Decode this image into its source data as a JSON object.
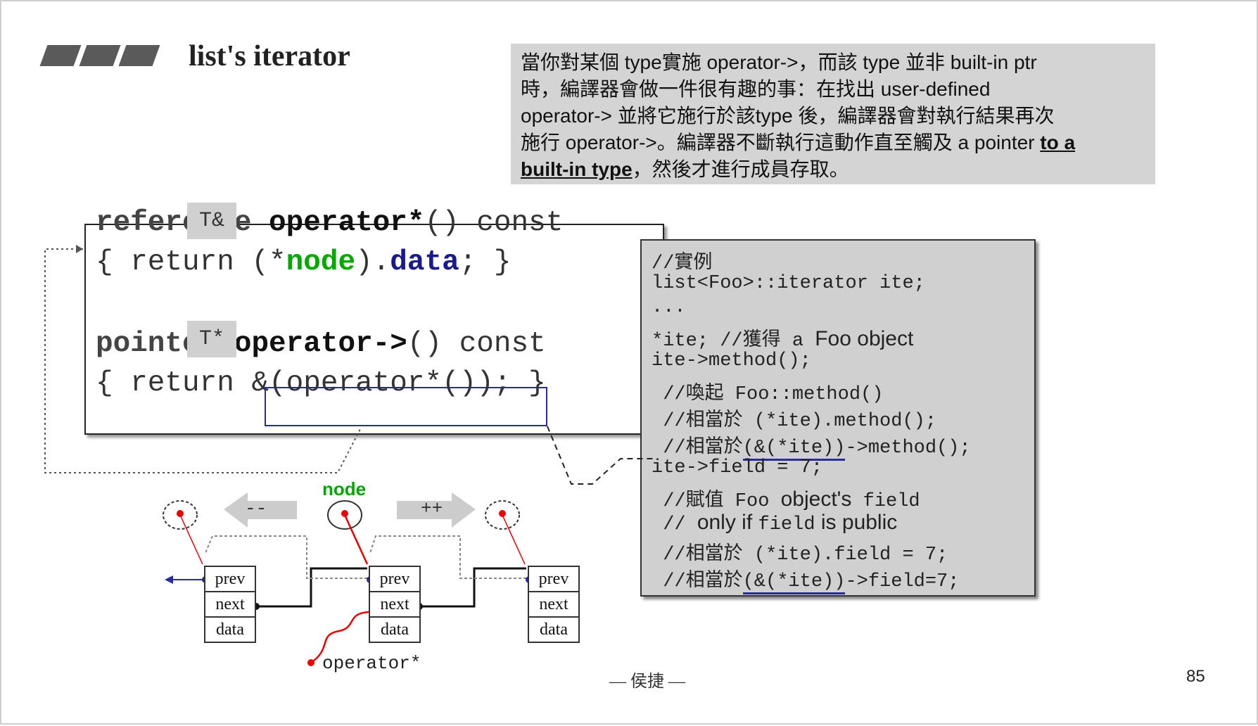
{
  "slide": {
    "title": "list's iterator",
    "page_number": "85",
    "footer": "— 侯捷 —"
  },
  "note": {
    "line1": "當你對某個 type實施 operator->，而該 type 並非 built-in ptr",
    "line2": "時，編譯器會做一件很有趣的事：在找出 user-defined",
    "line3": "operator-> 並將它施行於該type 後，編譯器會對執行結果再次",
    "line4_a": "施行 operator->。編譯器不斷執行這動作直至觸及 a pointer ",
    "line4_b": "to a",
    "line5_a": "built-in type",
    "line5_b": "，然後才進行成員存取。"
  },
  "code": {
    "tag_ref": "T&",
    "tag_ptr": "T*",
    "l1_a": "reference",
    "l1_b": "operator*",
    "l1_c": "() const",
    "l2_a": "{ return (*",
    "l2_node": "node",
    "l2_b": ").",
    "l2_data": "data",
    "l2_c": "; }",
    "l3_a": "pointer",
    "l3_b": "operator->",
    "l3_c": "() const",
    "l4_a": "{ return ",
    "l4_b": "&(operator*())",
    "l4_c": "; }"
  },
  "example": {
    "l1": "//實例",
    "l2": "list<Foo>::iterator ite;",
    "l3": "...",
    "l4_a": "*ite; //獲得 a ",
    "l4_b": "Foo object",
    "l5": "ite->method();",
    "l6": " //喚起 Foo::method()",
    "l7": " //相當於 (*ite).method();",
    "l8_a": " //相當於",
    "l8_b": "(&(*ite))",
    "l8_c": "->method();",
    "l9": "ite->field = 7;",
    "l10_a": " //賦值 Foo ",
    "l10_b": "object's",
    "l10_c": " field",
    "l11_a": " // ",
    "l11_b": "only if ",
    "l11_c": "field",
    "l11_d": " is public",
    "l12": " //相當於 (*ite).field = 7;",
    "l13_a": " //相當於",
    "l13_b": "(&(*ite))",
    "l13_c": "->field=7;"
  },
  "diagram": {
    "node_label": "node",
    "minus_label": "--",
    "plus_label": "++",
    "operator_label": "operator*",
    "field_prev": "prev",
    "field_next": "next",
    "field_data": "data"
  }
}
